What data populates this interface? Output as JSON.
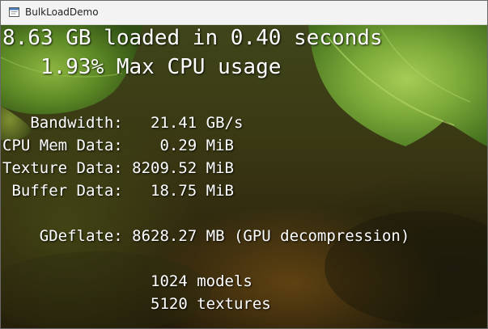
{
  "window": {
    "title": "BulkLoadDemo"
  },
  "hud": {
    "headline": "8.63 GB loaded in 0.40 seconds",
    "cpu_usage": "   1.93% Max CPU usage",
    "bandwidth": "   Bandwidth:   21.41 GB/s",
    "cpu_mem_data": "CPU Mem Data:    0.29 MiB",
    "texture_data": "Texture Data: 8209.52 MiB",
    "buffer_data": " Buffer Data:   18.75 MiB",
    "gdeflate": "    GDeflate: 8628.27 MB (GPU decompression)",
    "models": "                1024 models",
    "textures": "                5120 textures"
  },
  "icons": {
    "app_icon": "window-app-icon"
  },
  "colors": {
    "hud_text": "#ffffff",
    "titlebar_bg": "#f3f3f3",
    "leaf_green": "#7aa838"
  }
}
